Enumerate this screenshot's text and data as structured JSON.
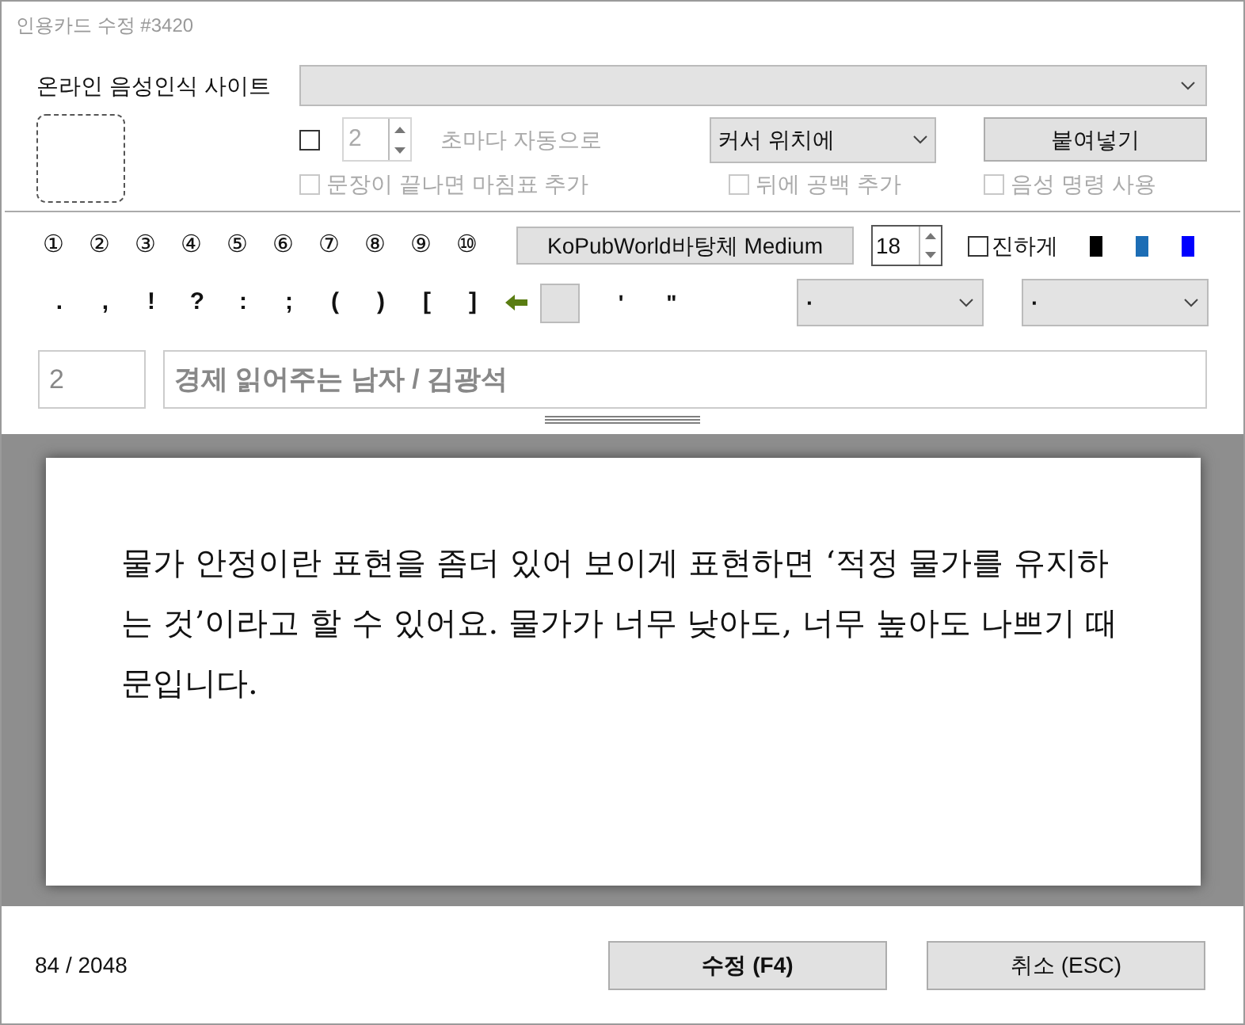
{
  "window": {
    "title": "인용카드 수정 #3420"
  },
  "speech_site": {
    "label": "온라인 음성인식 사이트"
  },
  "auto": {
    "checked": false,
    "interval": "2",
    "interval_suffix": "초마다 자동으로",
    "position": "커서 위치에",
    "paste_button": "붙여넣기"
  },
  "options": [
    {
      "label": "문장이 끝나면 마침표 추가",
      "checked": false,
      "disabled": true
    },
    {
      "label": "뒤에 공백 추가",
      "checked": false,
      "disabled": true
    },
    {
      "label": "음성 명령 사용",
      "checked": false,
      "disabled": true
    }
  ],
  "number_buttons": [
    "①",
    "②",
    "③",
    "④",
    "⑤",
    "⑥",
    "⑦",
    "⑧",
    "⑨",
    "⑩"
  ],
  "font_button": "KoPubWorld바탕체 Medium",
  "font_size": "18",
  "bold": {
    "label": "진하게",
    "checked": false
  },
  "colors": [
    {
      "color": "#000000"
    },
    {
      "color": "#1c6db5"
    },
    {
      "color": "#0000ff"
    }
  ],
  "punctuation": [
    ".",
    ",",
    "!",
    "?",
    ":",
    ";",
    "(",
    ")",
    "[",
    "]"
  ],
  "quotes": [
    "'",
    "\""
  ],
  "quote_selects": [
    "·",
    "·"
  ],
  "page": "2",
  "source": "경제 읽어주는 남자 / 김광석",
  "card_text": "물가 안정이란 표현을 좀더 있어 보이게 표현하면 ‘적정 물가를 유지하는 것’이라고 할 수 있어요. 물가가 너무 낮아도, 너무 높아도 나쁘기 때문입니다.",
  "counter": "84 / 2048",
  "buttons": [
    {
      "label": "수정 (F4)",
      "kind": "primary"
    },
    {
      "label": "취소 (ESC)",
      "kind": "secondary"
    }
  ]
}
